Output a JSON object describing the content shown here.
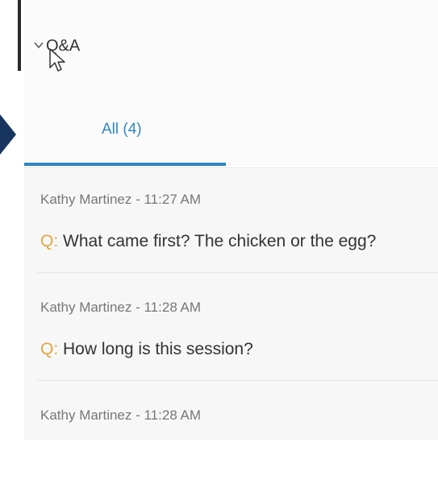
{
  "header": {
    "title": "Q&A"
  },
  "tabs": [
    {
      "label": "All (4)"
    }
  ],
  "questions": [
    {
      "meta": "Kathy Martinez - 11:27 AM",
      "prefix": "Q:",
      "text": "What came first? The chicken or the egg?"
    },
    {
      "meta": "Kathy Martinez - 11:28 AM",
      "prefix": "Q:",
      "text": "How long is this session?"
    },
    {
      "meta": "Kathy Martinez - 11:28 AM"
    }
  ],
  "colors": {
    "accent": "#2f86c2",
    "question_prefix": "#e2a640",
    "pointer_arrow": "#17355f"
  }
}
